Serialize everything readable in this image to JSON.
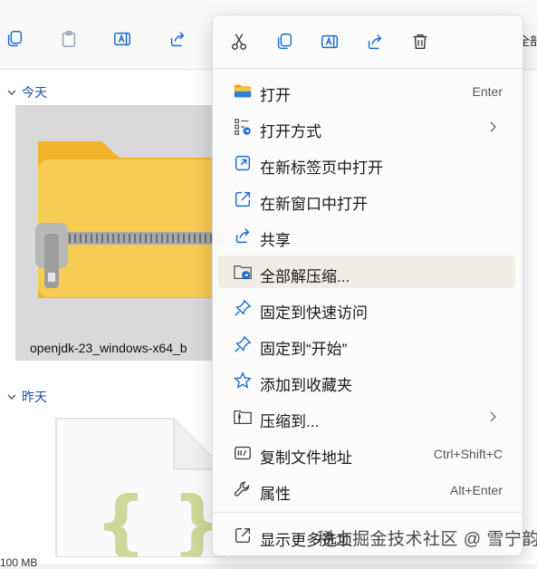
{
  "toolbar": {
    "more_text": "全部"
  },
  "groups": {
    "today": "今天",
    "yesterday": "昨天"
  },
  "files": {
    "zip_name": "openjdk-23_windows-x64_b",
    "size_text": "100 MB"
  },
  "context_menu": {
    "quick_actions": [
      "cut-icon",
      "copy-icon",
      "rename-icon",
      "share-icon",
      "delete-icon"
    ],
    "items": [
      {
        "label": "打开",
        "shortcut": "Enter",
        "icon": "folder-icon"
      },
      {
        "label": "打开方式",
        "submenu": true,
        "icon": "open-with-icon"
      },
      {
        "label": "在新标签页中打开",
        "icon": "new-tab-icon"
      },
      {
        "label": "在新窗口中打开",
        "icon": "new-window-icon"
      },
      {
        "label": "共享",
        "icon": "share-icon"
      },
      {
        "label": "全部解压缩...",
        "icon": "extract-icon"
      },
      {
        "label": "固定到快速访问",
        "icon": "pin-icon"
      },
      {
        "label": "固定到“开始”",
        "icon": "pin-icon"
      },
      {
        "label": "添加到收藏夹",
        "icon": "star-icon"
      },
      {
        "label": "压缩到...",
        "submenu": true,
        "icon": "compress-icon"
      },
      {
        "label": "复制文件地址",
        "shortcut": "Ctrl+Shift+C",
        "icon": "copy-path-icon"
      },
      {
        "label": "属性",
        "shortcut": "Alt+Enter",
        "icon": "wrench-icon"
      },
      {
        "label": "显示更多选项",
        "icon": "more-options-icon"
      }
    ]
  },
  "watermark": "稀土掘金技术社区 @ 雪宁韵",
  "colors": {
    "accent": "#1a6bd1",
    "hover": "#f1ede6",
    "folder_yellow": "#f5c542"
  }
}
